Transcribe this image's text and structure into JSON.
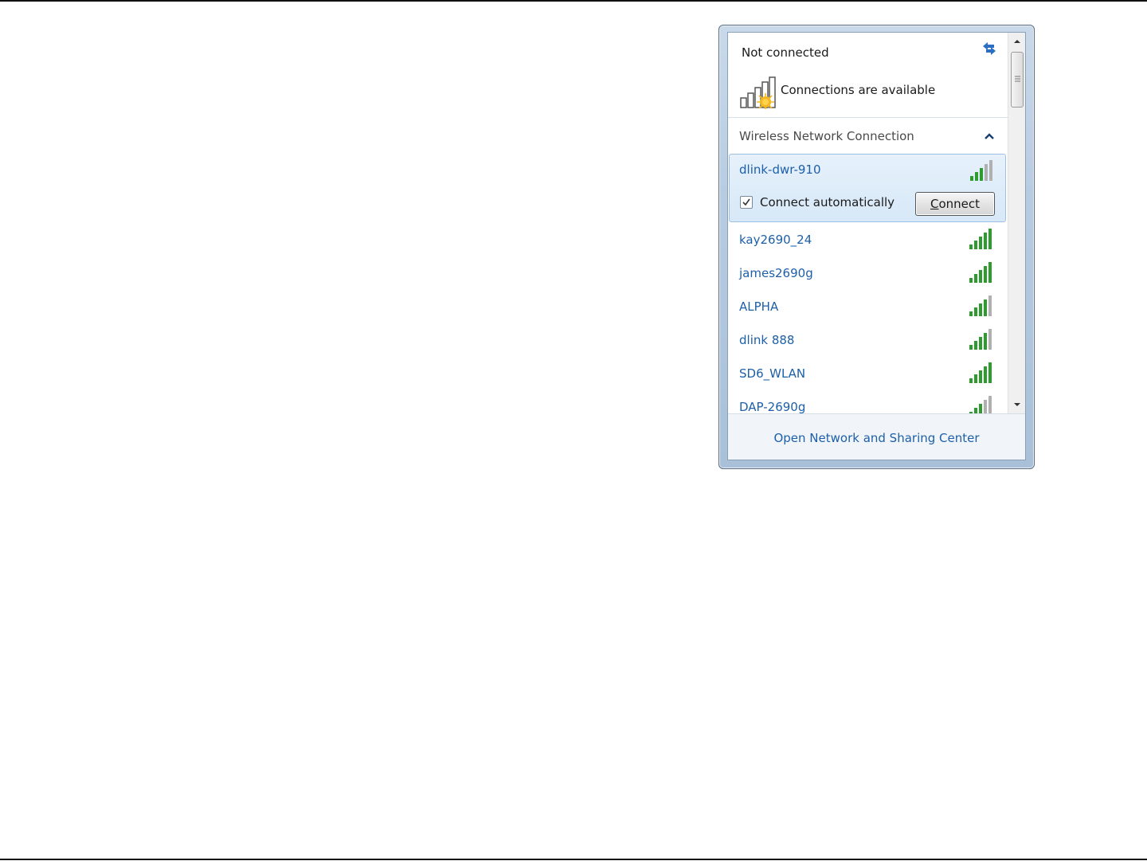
{
  "status": {
    "title": "Not connected",
    "availability": "Connections are available"
  },
  "section": {
    "title": "Wireless Network Connection"
  },
  "selected_network": {
    "name": "dlink-dwr-910",
    "signal_bars": 3,
    "connect_automatically_label": "Connect automatically",
    "connect_automatically_checked": true,
    "connect_button_label_underlined": "C",
    "connect_button_label_rest": "onnect"
  },
  "networks": [
    {
      "name": "kay2690_24",
      "signal_bars": 5
    },
    {
      "name": "james2690g",
      "signal_bars": 5
    },
    {
      "name": "ALPHA",
      "signal_bars": 4
    },
    {
      "name": "dlink 888",
      "signal_bars": 4
    },
    {
      "name": "SD6_WLAN",
      "signal_bars": 5
    },
    {
      "name": "DAP-2690g",
      "signal_bars": 3
    }
  ],
  "footer": {
    "link": "Open Network and Sharing Center"
  },
  "colors": {
    "link_blue": "#1d5fa8",
    "signal_green": "#2e9b2e",
    "signal_gray": "#b0b0b0"
  }
}
